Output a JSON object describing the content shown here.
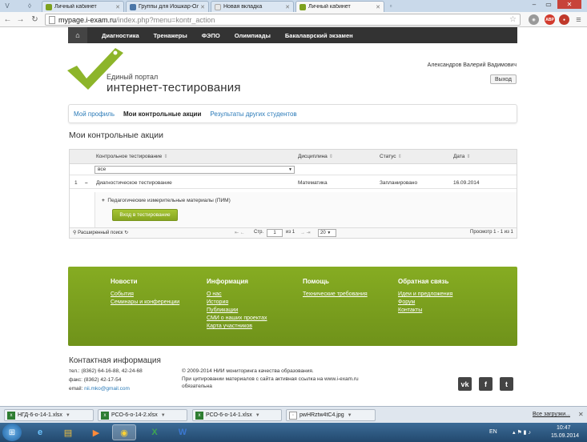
{
  "browser": {
    "tabs": [
      {
        "label": "Личный кабинет",
        "favicon_color": "#7da11f"
      },
      {
        "label": "Группы для Йошкар-Ол",
        "favicon_color": "#4a76a8"
      },
      {
        "label": "Новая вкладка",
        "favicon_color": "#dddddd"
      },
      {
        "label": "Личный кабинет",
        "favicon_color": "#7da11f"
      }
    ],
    "url_host": "mypage.i-exam.ru",
    "url_path": "/index.php?menu=kontr_action",
    "ext_abp": "ABP"
  },
  "site_nav": {
    "items": [
      "Диагностика",
      "Тренажеры",
      "ФЭПО",
      "Олимпиады",
      "Бакалаврский экзамен"
    ]
  },
  "header": {
    "logo_small": "Единый портал",
    "logo_big": "интернет-тестирования",
    "user_name": "Александров Валерий Вадимович",
    "logout_label": "Выход"
  },
  "tabs": {
    "my_profile": "Мой профиль",
    "my_actions": "Мои контрольные акции",
    "other_results": "Результаты других студентов"
  },
  "section_title": "Мои контрольные акции",
  "grid": {
    "columns": [
      "Контрольное тестирование",
      "Дисциплина",
      "Статус",
      "Дата"
    ],
    "sort_glyph": "⇕",
    "filter_value": "все",
    "row": {
      "num": "1",
      "toggle": "–",
      "name": "Диагностическое тестирование",
      "discipline": "Математика",
      "status": "Запланировано",
      "date": "16.09.2014"
    },
    "sub_item": "Педагогические измерительные материалы (ПИМ)",
    "enter_button": "Вход в тестирование",
    "pager": {
      "advanced_search": "Расширенный поиск",
      "page_label": "Стр.",
      "page_value": "1",
      "of_label": "из 1",
      "rows_value": "20",
      "view_text": "Просмотр 1 - 1 из 1"
    }
  },
  "footer": {
    "columns": [
      {
        "title": "Новости",
        "links": [
          "События",
          "Семинары и конференции"
        ]
      },
      {
        "title": "Информация",
        "links": [
          "О нас",
          "История",
          "Публикации",
          "СМИ о наших проектах",
          "Карта участников"
        ]
      },
      {
        "title": "Помощь",
        "links": [
          "Технические требования"
        ]
      },
      {
        "title": "Обратная связь",
        "links": [
          "Идеи и предложения",
          "Форум",
          "Контакты"
        ]
      }
    ]
  },
  "contacts": {
    "title": "Контактная информация",
    "phone": "тел.: (8362) 64-16-88, 42-24-68",
    "fax": "факс: (8362) 42-17-54",
    "email_label": "email:",
    "email": "nii.mko@gmail.com",
    "copyright": "© 2009-2014 НИИ мониторинга качества образования.",
    "cite_note_1": "При цитировании материалов с сайта активная ссылка на www.i-exam.ru",
    "cite_note_2": "обязательна",
    "social": [
      "vk",
      "f",
      "twitter"
    ]
  },
  "downloads": {
    "items": [
      {
        "name": "НГД-6-о-14-1.xlsx",
        "type": "xlsx"
      },
      {
        "name": "РСО-6-о-14-2.xlsx",
        "type": "xlsx"
      },
      {
        "name": "РСО-6-о-14-1.xlsx",
        "type": "xlsx"
      },
      {
        "name": "pwHRztw4tC4.jpg",
        "type": "jpg"
      }
    ],
    "show_all": "Все загрузки..."
  },
  "taskbar": {
    "lang": "EN",
    "time": "10:47",
    "date": "15.09.2014"
  }
}
